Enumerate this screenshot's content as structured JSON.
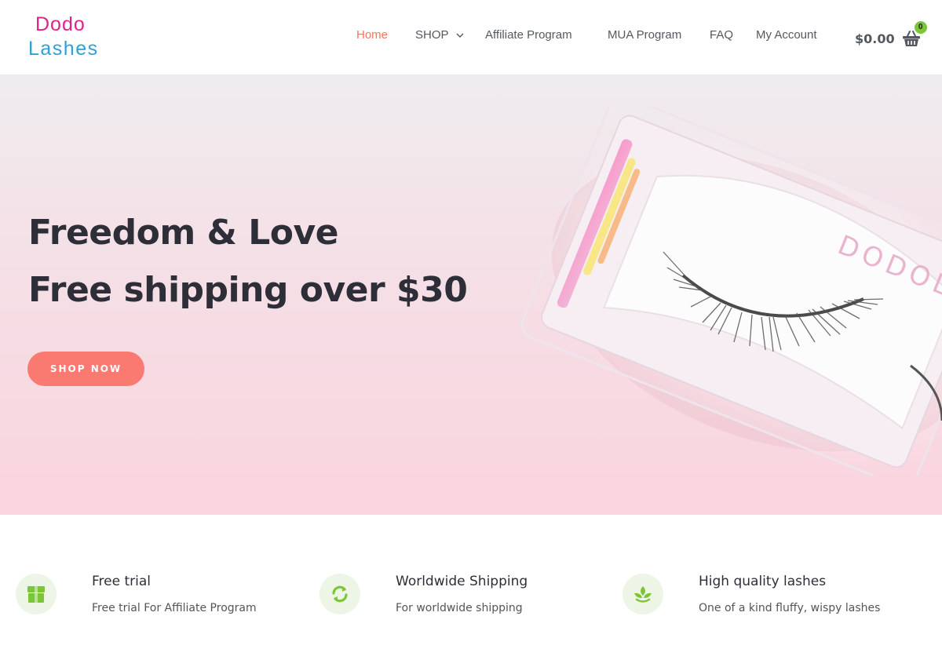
{
  "brand": {
    "line1": "Dodo",
    "line2": "Lashes"
  },
  "nav": [
    {
      "label": "Home",
      "active": true
    },
    {
      "label": "SHOP",
      "has_dropdown": true
    },
    {
      "label": "Affiliate Program"
    },
    {
      "label": "MUA Program"
    },
    {
      "label": "FAQ"
    },
    {
      "label": "My Account"
    }
  ],
  "cart": {
    "total": "$0.00",
    "count": "0",
    "icon": "basket-icon"
  },
  "hero": {
    "title": "Freedom & Love",
    "subtitle": "Free shipping over $30",
    "button_label": "SHOP NOW",
    "image_text": "DODOLA"
  },
  "features": [
    {
      "icon": "box-icon",
      "title": "Free trial",
      "text": "Free trial For Affiliate Program"
    },
    {
      "icon": "refresh-icon",
      "title": "Worldwide Shipping",
      "text": "For worldwide shipping"
    },
    {
      "icon": "leaf-icon",
      "title": "High quality lashes",
      "text": "One of a kind fluffy, wispy lashes"
    }
  ],
  "colors": {
    "accent": "#f4755a",
    "button": "#fa7a72",
    "logo_pink": "#e0218a",
    "logo_blue": "#2f9fd6",
    "icon_green": "#7cc537"
  }
}
